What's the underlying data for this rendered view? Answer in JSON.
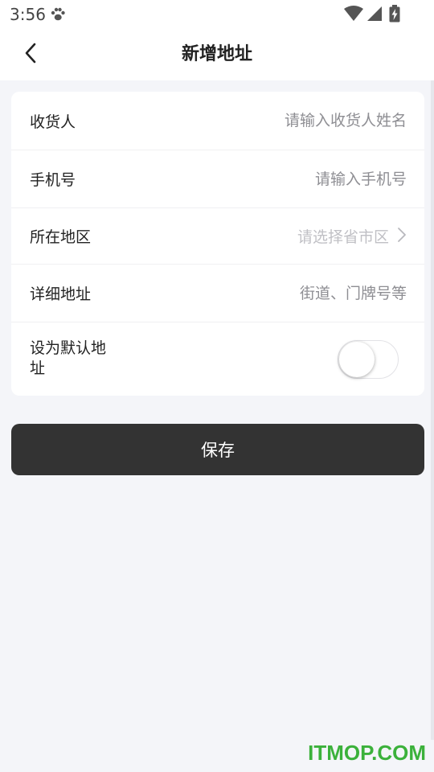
{
  "status_bar": {
    "time": "3:56",
    "icons": [
      "paw-icon",
      "wifi-icon",
      "signal-icon",
      "battery-charging-icon"
    ]
  },
  "header": {
    "title": "新增地址",
    "back_icon": "chevron-left-icon"
  },
  "form": {
    "recipient": {
      "label": "收货人",
      "value": "",
      "placeholder": "请输入收货人姓名"
    },
    "phone": {
      "label": "手机号",
      "value": "",
      "placeholder": "请输入手机号"
    },
    "region": {
      "label": "所在地区",
      "placeholder": "请选择省市区",
      "icon": "chevron-right-icon"
    },
    "detail": {
      "label": "详细地址",
      "value": "",
      "placeholder": "街道、门牌号等"
    },
    "default": {
      "label": "设为默认地址",
      "enabled": false
    }
  },
  "actions": {
    "save_label": "保存"
  },
  "watermark": "ITMOP.COM",
  "colors": {
    "background": "#f4f5f9",
    "card": "#ffffff",
    "primary_button": "#333333",
    "placeholder": "#8e8e93",
    "watermark": "#3bb13b"
  }
}
